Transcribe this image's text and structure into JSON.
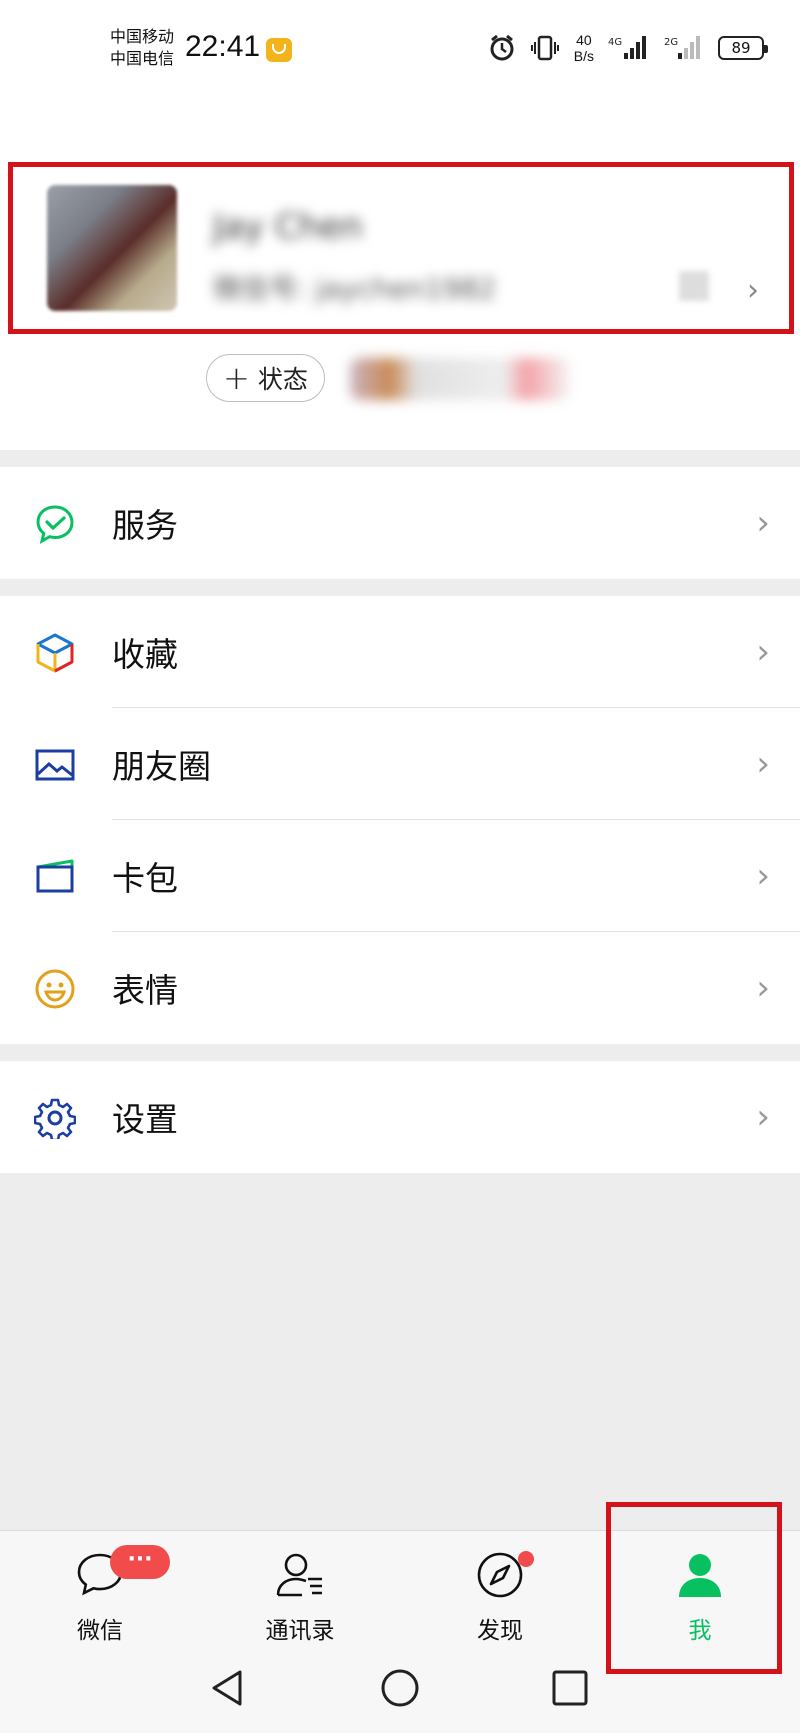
{
  "status_bar": {
    "carrier_1": "中国移动",
    "carrier_2": "中国电信",
    "time": "22:41",
    "net_speed_value": "40",
    "net_speed_unit": "B/s",
    "signal_1_label": "4G",
    "signal_2_label": "2G",
    "battery": "89"
  },
  "profile": {
    "nickname": "Jay Chen",
    "wechat_id": "微信号: jaychen1982",
    "status_button": "状态"
  },
  "menu_sections": [
    [
      {
        "label": "服务",
        "icon": "services-icon",
        "color": "#07c160"
      }
    ],
    [
      {
        "label": "收藏",
        "icon": "favorites-icon",
        "color": "#1976d2"
      },
      {
        "label": "朋友圈",
        "icon": "moments-icon",
        "color": "#1a3fa0"
      },
      {
        "label": "卡包",
        "icon": "card-wallet-icon",
        "color": "#1a3fa0"
      },
      {
        "label": "表情",
        "icon": "sticker-icon",
        "color": "#e3a01b"
      }
    ],
    [
      {
        "label": "设置",
        "icon": "settings-icon",
        "color": "#1a3fa0"
      }
    ]
  ],
  "tabs": [
    {
      "label": "微信",
      "icon": "chat-icon"
    },
    {
      "label": "通讯录",
      "icon": "contacts-icon"
    },
    {
      "label": "发现",
      "icon": "discover-icon"
    },
    {
      "label": "我",
      "icon": "me-icon"
    }
  ],
  "badges": {
    "chats": "···"
  },
  "colors": {
    "accent": "#07c160",
    "highlight_border": "#d3121a",
    "badge": "#f24b4b"
  }
}
